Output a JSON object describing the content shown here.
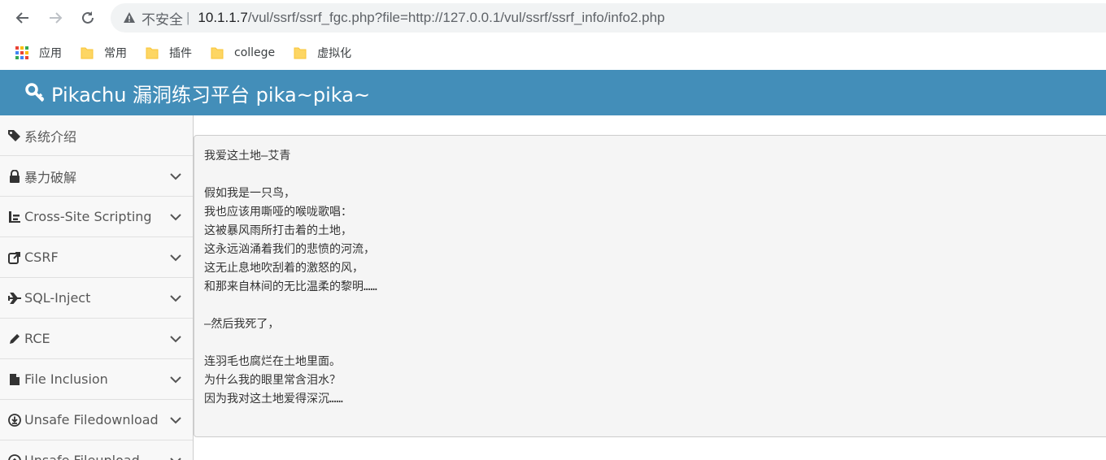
{
  "browser": {
    "insecure_label": "不安全",
    "separator": "|",
    "url_host": "10.1.1.7",
    "url_path": "/vul/ssrf/ssrf_fgc.php?file=http://127.0.0.1/vul/ssrf/ssrf_info/info2.php"
  },
  "bookmarks": [
    {
      "label": "应用",
      "icon": "apps-grid-icon"
    },
    {
      "label": "常用",
      "icon": "folder-icon"
    },
    {
      "label": "插件",
      "icon": "folder-icon"
    },
    {
      "label": "college",
      "icon": "folder-icon"
    },
    {
      "label": "虚拟化",
      "icon": "folder-icon"
    }
  ],
  "app": {
    "title": "Pikachu 漏洞练习平台 pika~pika~",
    "header_color": "#438eb9"
  },
  "sidebar": {
    "items": [
      {
        "label": "系统介绍",
        "icon": "tags-icon",
        "expandable": false
      },
      {
        "label": "暴力破解",
        "icon": "lock-icon",
        "expandable": true
      },
      {
        "label": "Cross-Site Scripting",
        "icon": "sitemap-icon",
        "expandable": true
      },
      {
        "label": "CSRF",
        "icon": "share-icon",
        "expandable": true
      },
      {
        "label": "SQL-Inject",
        "icon": "plane-icon",
        "expandable": true
      },
      {
        "label": "RCE",
        "icon": "pencil-icon",
        "expandable": true
      },
      {
        "label": "File Inclusion",
        "icon": "file-icon",
        "expandable": true
      },
      {
        "label": "Unsafe Filedownload",
        "icon": "download-icon",
        "expandable": true
      },
      {
        "label": "Unsafe Fileupload",
        "icon": "upload-icon",
        "expandable": true
      }
    ]
  },
  "content": {
    "lines": [
      "我爱这土地–艾青",
      "",
      "假如我是一只鸟，",
      "我也应该用嘶哑的喉咙歌唱：",
      "这被暴风雨所打击着的土地，",
      "这永远汹涌着我们的悲愤的河流，",
      "这无止息地吹刮着的激怒的风，",
      "和那来自林间的无比温柔的黎明……",
      "",
      "—然后我死了，",
      "",
      "连羽毛也腐烂在土地里面。",
      "为什么我的眼里常含泪水？",
      "因为我对这土地爱得深沉……"
    ]
  }
}
